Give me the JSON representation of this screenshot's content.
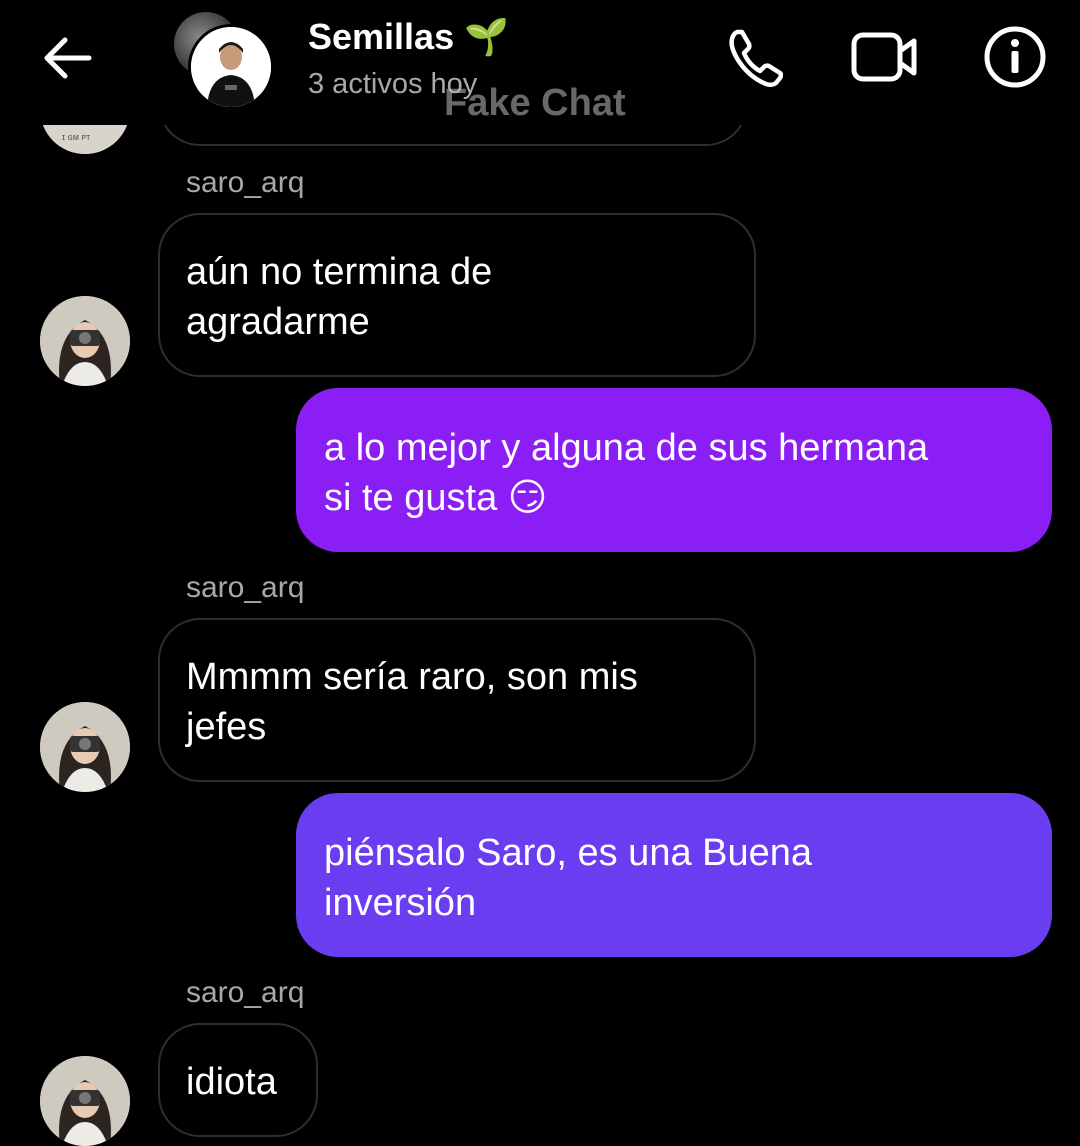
{
  "header": {
    "title": "Semillas",
    "title_emoji": "🌱",
    "subtitle": "3 activos hoy",
    "watermark": "Fake Chat"
  },
  "icons": {
    "back": "back-arrow-icon",
    "call": "phone-icon",
    "video": "video-camera-icon",
    "info": "info-icon"
  },
  "colors": {
    "background": "#000000",
    "outgoing_top": "#8a1ef5",
    "outgoing_bottom": "#6a3ef0",
    "incoming_border": "#2e2e2e",
    "secondary_text": "#a8a8a8"
  },
  "messages": [
    {
      "sender": "saro_arq",
      "line1": "aún no termina de",
      "line2": "agradarme"
    },
    {
      "line1": "a lo mejor y alguna de sus hermana",
      "line2": "si te gusta",
      "emoji": "😏"
    },
    {
      "sender": "saro_arq",
      "line1": "Mmmm sería raro, son mis",
      "line2": "jefes"
    },
    {
      "line1": "piénsalo Saro, es una Buena",
      "line2": "inversión"
    },
    {
      "sender": "saro_arq",
      "line1": "idiota"
    }
  ]
}
